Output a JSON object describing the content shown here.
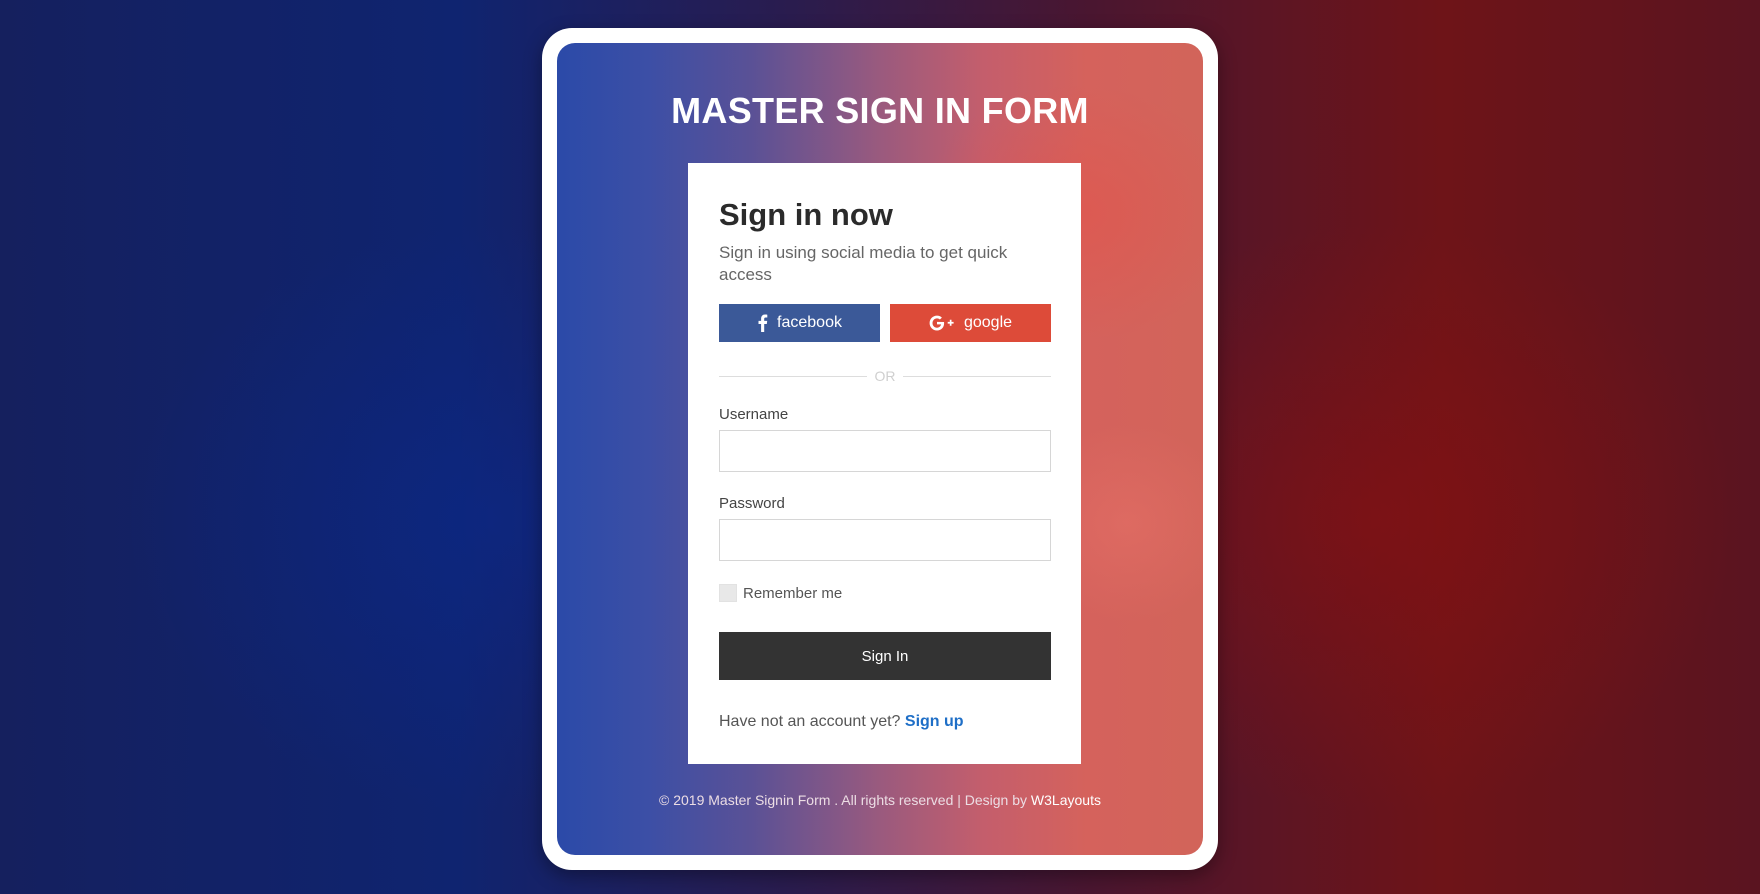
{
  "page": {
    "title": "MASTER SIGN IN FORM"
  },
  "card": {
    "heading": "Sign in now",
    "subtitle": "Sign in using social media to get quick access",
    "social": {
      "facebook_label": "facebook",
      "facebook_icon": "facebook-icon",
      "facebook_color": "#3b5998",
      "google_label": "google",
      "google_icon": "google-plus-icon",
      "google_color": "#dd4b39"
    },
    "divider_text": "OR",
    "username": {
      "label": "Username",
      "value": "",
      "placeholder": ""
    },
    "password": {
      "label": "Password",
      "value": "",
      "placeholder": ""
    },
    "remember_label": "Remember me",
    "remember_checked": false,
    "submit_label": "Sign In",
    "submit_color": "#333333",
    "signup_prompt": "Have not an account yet?",
    "signup_link": "Sign up",
    "link_color": "#1f6fc7"
  },
  "footer": {
    "text": "© 2019 Master Signin Form . All rights reserved | Design by",
    "link": "W3Layouts"
  }
}
